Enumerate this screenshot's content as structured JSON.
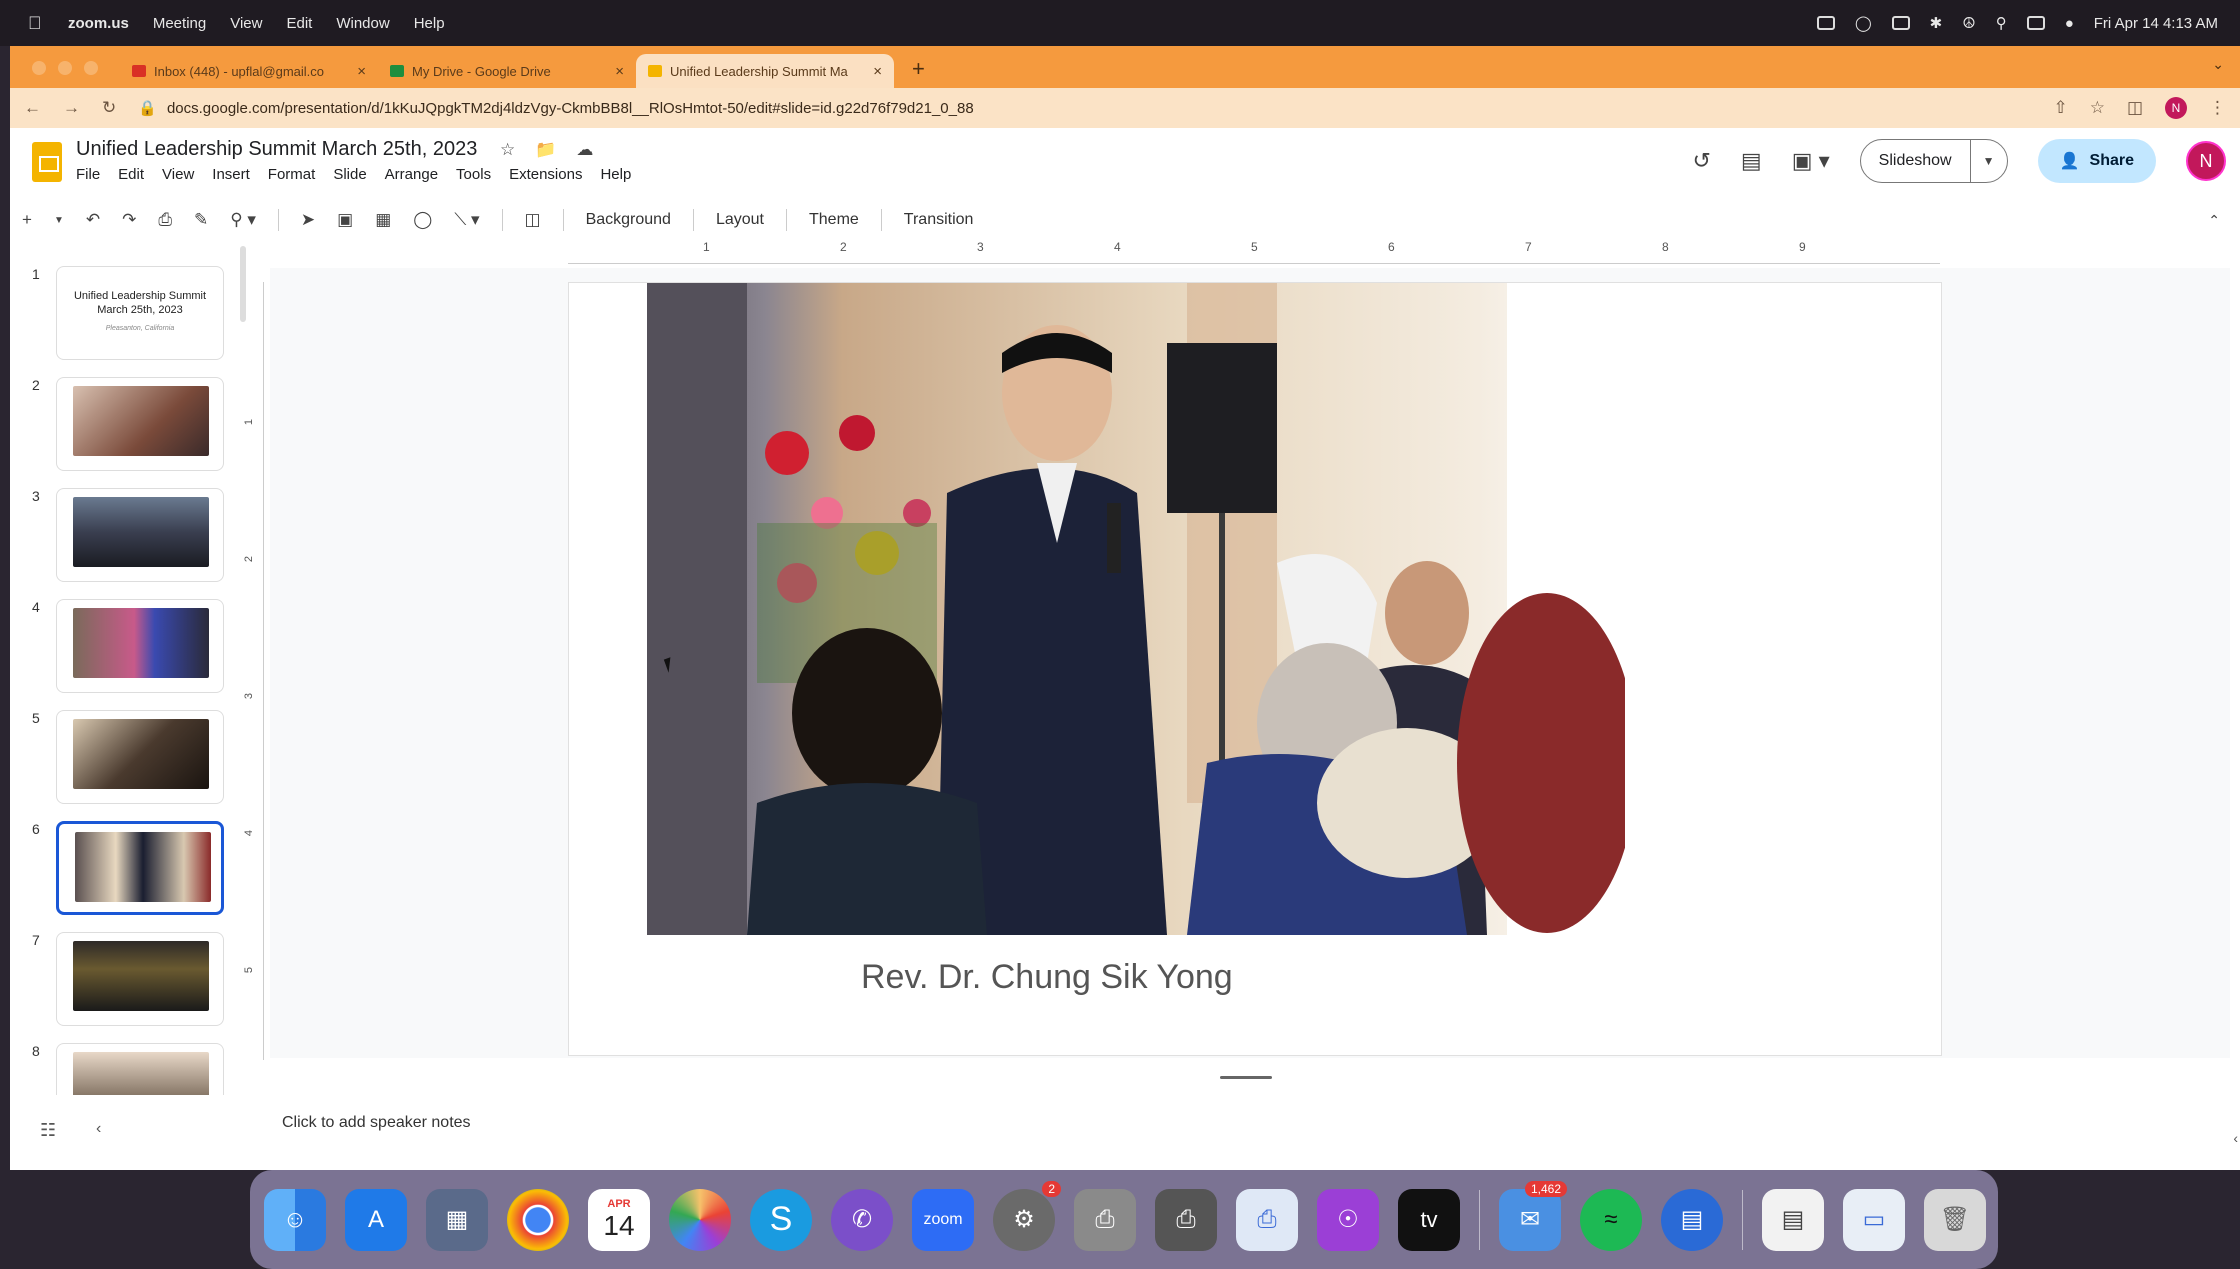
{
  "menubar": {
    "app": "zoom.us",
    "items": [
      "Meeting",
      "View",
      "Edit",
      "Window",
      "Help"
    ],
    "clock": "Fri Apr 14  4:13 AM"
  },
  "tabs": [
    {
      "title": "Inbox (448) - upflal@gmail.co",
      "close": "×",
      "color": "#d93025"
    },
    {
      "title": "My Drive - Google Drive",
      "close": "×",
      "color": "#1e8e3e"
    },
    {
      "title": "Unified Leadership Summit Ma",
      "close": "×",
      "color": "#f4b400"
    }
  ],
  "new_tab": "+",
  "address": {
    "url": "docs.google.com/presentation/d/1kKuJQpgkTM2dj4ldzVgy-CkmbBB8l__RlOsHmtot-50/edit#slide=id.g22d76f79d21_0_88",
    "avatar": "N"
  },
  "doc": {
    "title": "Unified Leadership Summit  March 25th, 2023",
    "menus": [
      "File",
      "Edit",
      "View",
      "Insert",
      "Format",
      "Slide",
      "Arrange",
      "Tools",
      "Extensions",
      "Help"
    ]
  },
  "header_right": {
    "slideshow": "Slideshow",
    "share": "Share",
    "avatar": "N"
  },
  "toolbar": {
    "background": "Background",
    "layout": "Layout",
    "theme": "Theme",
    "transition": "Transition"
  },
  "filmstrip": [
    {
      "num": "1",
      "title_line1": "Unified Leadership Summit",
      "title_line2": "March 25th, 2023",
      "subtitle": "Pleasanton, California",
      "photo_color": ""
    },
    {
      "num": "2",
      "photo_color": "#7a4a3a"
    },
    {
      "num": "3",
      "photo_color": "#3a3f50"
    },
    {
      "num": "4",
      "photo_color": "#5a4a6a"
    },
    {
      "num": "5",
      "photo_color": "#4a3a2e"
    },
    {
      "num": "6",
      "photo_color": "#6a5a4a"
    },
    {
      "num": "7",
      "photo_color": "#2e2a28"
    },
    {
      "num": "8",
      "photo_color": "#8a7a6a"
    }
  ],
  "ruler_h": [
    "1",
    "2",
    "3",
    "4",
    "5",
    "6",
    "7",
    "8",
    "9"
  ],
  "ruler_v": [
    "1",
    "2",
    "3",
    "4",
    "5"
  ],
  "slide": {
    "caption": "Rev. Dr. Chung Sik Yong"
  },
  "notes_placeholder": "Click to add speaker notes",
  "dock": [
    {
      "name": "finder",
      "label": "",
      "color": "#3d8fe8"
    },
    {
      "name": "app-store",
      "label": "A",
      "color": "#1f7ae8"
    },
    {
      "name": "launchpad",
      "label": "",
      "color": "#5a6a8a"
    },
    {
      "name": "chrome",
      "label": "",
      "color": "#e8e8e8"
    },
    {
      "name": "calendar",
      "label": "14",
      "month": "APR",
      "color": "#ffffff"
    },
    {
      "name": "photos",
      "label": "",
      "color": "#f6c26b"
    },
    {
      "name": "skype",
      "label": "S",
      "color": "#1a9be0"
    },
    {
      "name": "viber",
      "label": "",
      "color": "#7b4fc9"
    },
    {
      "name": "zoom",
      "label": "zoom",
      "color": "#2d6cf5"
    },
    {
      "name": "system-preferences",
      "label": "",
      "color": "#6a6a6a",
      "badge": "2"
    },
    {
      "name": "printer-1",
      "label": "",
      "color": "#8a8a8a"
    },
    {
      "name": "printer-2",
      "label": "",
      "color": "#555555"
    },
    {
      "name": "printer-3",
      "label": "",
      "color": "#dfe8f6"
    },
    {
      "name": "podcasts",
      "label": "",
      "color": "#9b3fd6"
    },
    {
      "name": "apple-tv",
      "label": "tv",
      "color": "#111111"
    },
    {
      "name": "mail",
      "label": "",
      "color": "#4a90e2",
      "badge": "1,462"
    },
    {
      "name": "spotify",
      "label": "",
      "color": "#1db954"
    },
    {
      "name": "app-blue",
      "label": "",
      "color": "#2a6ad6"
    },
    {
      "name": "preview-doc",
      "label": "",
      "color": "#f2f2f2"
    },
    {
      "name": "screen",
      "label": "",
      "color": "#e8eef6"
    },
    {
      "name": "trash",
      "label": "",
      "color": "#d8d8d8"
    }
  ]
}
